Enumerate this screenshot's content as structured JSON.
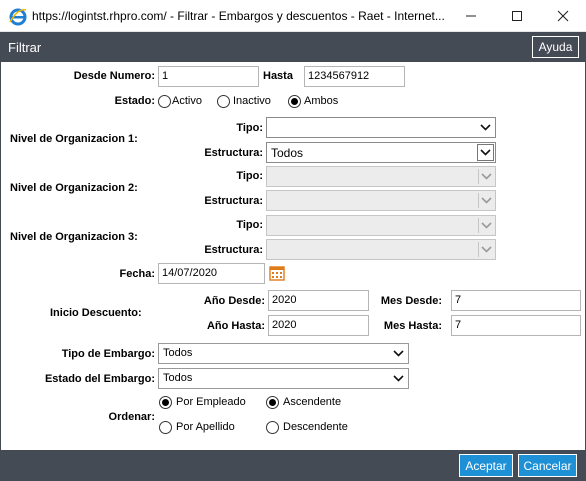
{
  "window": {
    "title": "https://logintst.rhpro.com/ - Filtrar - Embargos y descuentos - Raet - Internet..."
  },
  "dialog": {
    "title": "Filtrar",
    "help_button": "Ayuda"
  },
  "form": {
    "desde_numero": {
      "label": "Desde Numero:",
      "value": "1"
    },
    "hasta": {
      "label": "Hasta",
      "value": "1234567912"
    },
    "estado": {
      "label": "Estado:",
      "options": [
        "Activo",
        "Inactivo",
        "Ambos"
      ],
      "selected": "Ambos"
    },
    "org_levels": [
      {
        "label": "Nivel de Organizacion 1:",
        "tipo_label": "Tipo:",
        "tipo_value": "",
        "estructura_label": "Estructura:",
        "estructura_value": "Todos",
        "enabled": true
      },
      {
        "label": "Nivel de Organizacion 2:",
        "tipo_label": "Tipo:",
        "tipo_value": "",
        "estructura_label": "Estructura:",
        "estructura_value": "",
        "enabled": false
      },
      {
        "label": "Nivel de Organizacion 3:",
        "tipo_label": "Tipo:",
        "tipo_value": "",
        "estructura_label": "Estructura:",
        "estructura_value": "",
        "enabled": false
      }
    ],
    "fecha": {
      "label": "Fecha:",
      "value": "14/07/2020"
    },
    "inicio_descuento": {
      "label": "Inicio Descuento:",
      "anio_desde_label": "Año Desde:",
      "anio_desde": "2020",
      "mes_desde_label": "Mes Desde:",
      "mes_desde": "7",
      "anio_hasta_label": "Año Hasta:",
      "anio_hasta": "2020",
      "mes_hasta_label": "Mes Hasta:",
      "mes_hasta": "7"
    },
    "tipo_embargo": {
      "label": "Tipo de Embargo:",
      "value": "Todos"
    },
    "estado_embargo": {
      "label": "Estado del Embargo:",
      "value": "Todos"
    },
    "ordenar": {
      "label": "Ordenar:",
      "by_options": [
        "Por Empleado",
        "Por Apellido"
      ],
      "by_selected": "Por Empleado",
      "dir_options": [
        "Ascendente",
        "Descendente"
      ],
      "dir_selected": "Ascendente"
    }
  },
  "footer": {
    "accept": "Aceptar",
    "cancel": "Cancelar"
  },
  "colors": {
    "header_bg": "#454b55",
    "button_blue": "#1e90d6",
    "calendar_orange": "#e07b1a"
  }
}
